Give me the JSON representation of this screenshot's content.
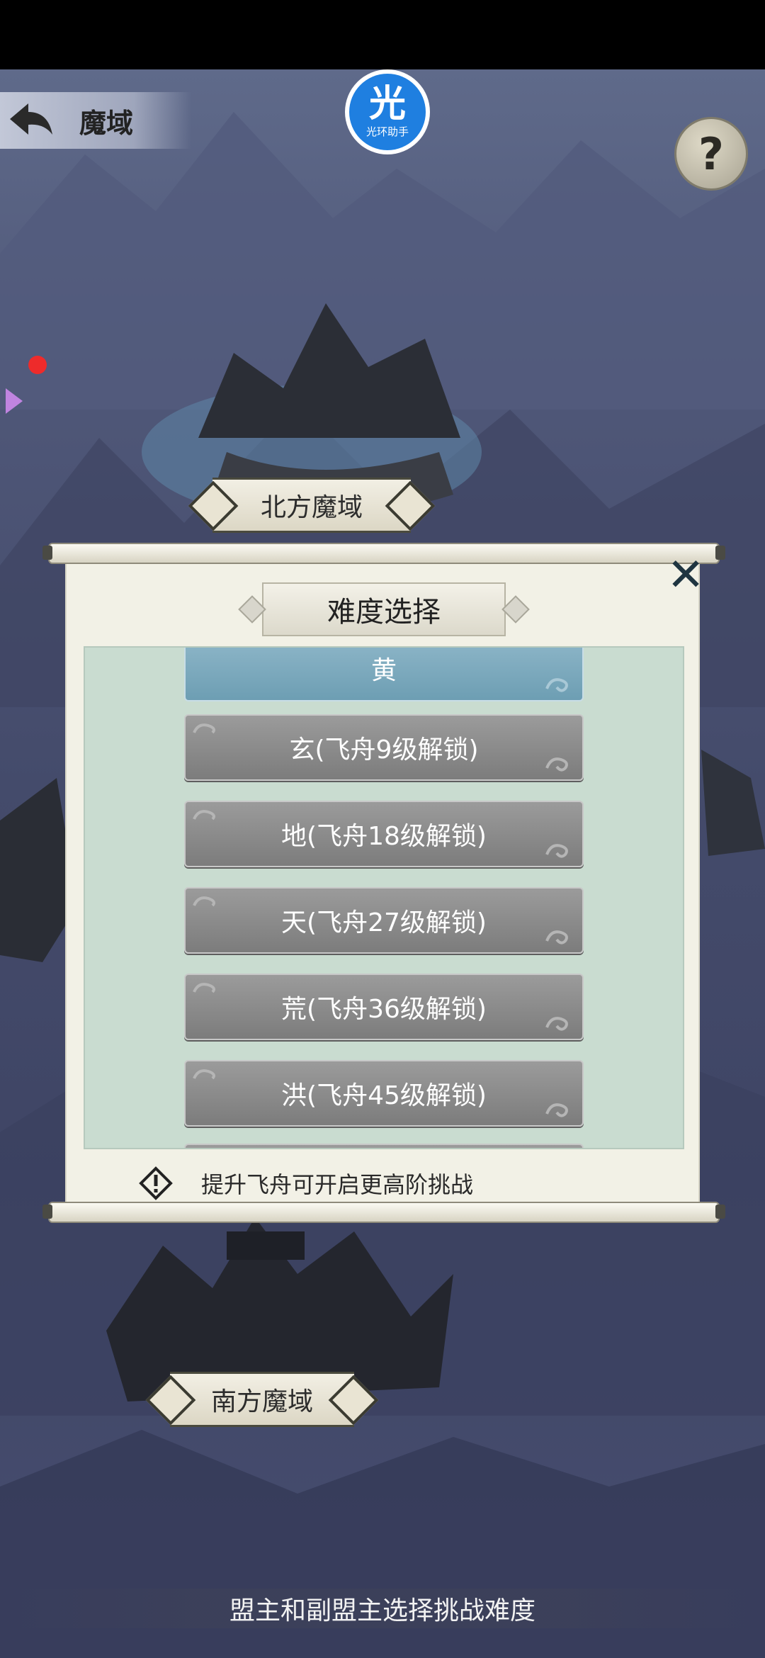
{
  "header": {
    "back_label": "魔域",
    "halo_char": "光",
    "halo_name": "光环助手",
    "help_symbol": "?"
  },
  "map": {
    "north_label": "北方魔域",
    "south_label": "南方魔域"
  },
  "dialog": {
    "title": "难度选择",
    "close_symbol": "✕",
    "options": [
      {
        "label": "黄",
        "state": "selected"
      },
      {
        "label": "玄(飞舟9级解锁)",
        "state": "locked"
      },
      {
        "label": "地(飞舟18级解锁)",
        "state": "locked"
      },
      {
        "label": "天(飞舟27级解锁)",
        "state": "locked"
      },
      {
        "label": "荒(飞舟36级解锁)",
        "state": "locked"
      },
      {
        "label": "洪(飞舟45级解锁)",
        "state": "locked"
      }
    ],
    "tip": "提升飞舟可开启更高阶挑战"
  },
  "footer": {
    "text": "盟主和副盟主选择挑战难度"
  },
  "colors": {
    "selected_option": "#7aa9bd",
    "locked_option": "#8a8a8a",
    "list_bg": "#c9dcd0",
    "paper": "#f2f1e6"
  }
}
